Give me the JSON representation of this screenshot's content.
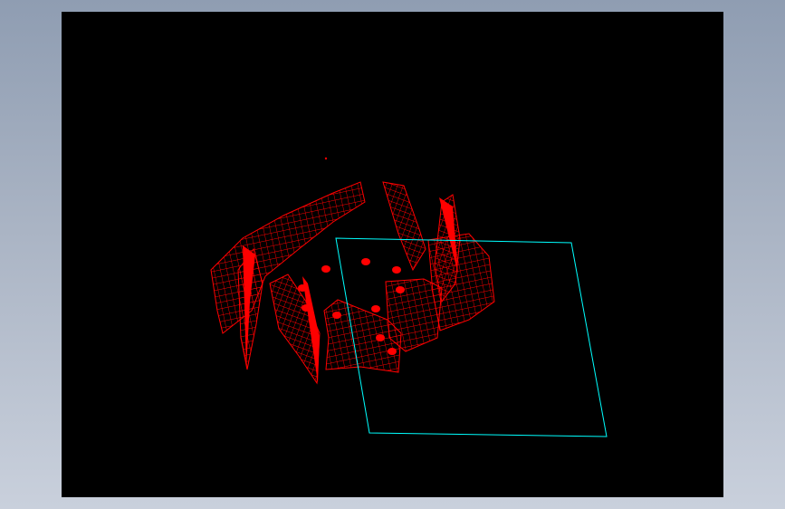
{
  "window": {
    "title": ""
  },
  "viewport": {
    "background_color": "#000000",
    "frame_gradient": [
      "#8f9db2",
      "#c9d0dc"
    ]
  },
  "model": {
    "description_color": "#ff0000",
    "mesh_color": "#ff0000",
    "plane_color": "#00ffff",
    "blade_count": 8,
    "hole_count": 10
  }
}
